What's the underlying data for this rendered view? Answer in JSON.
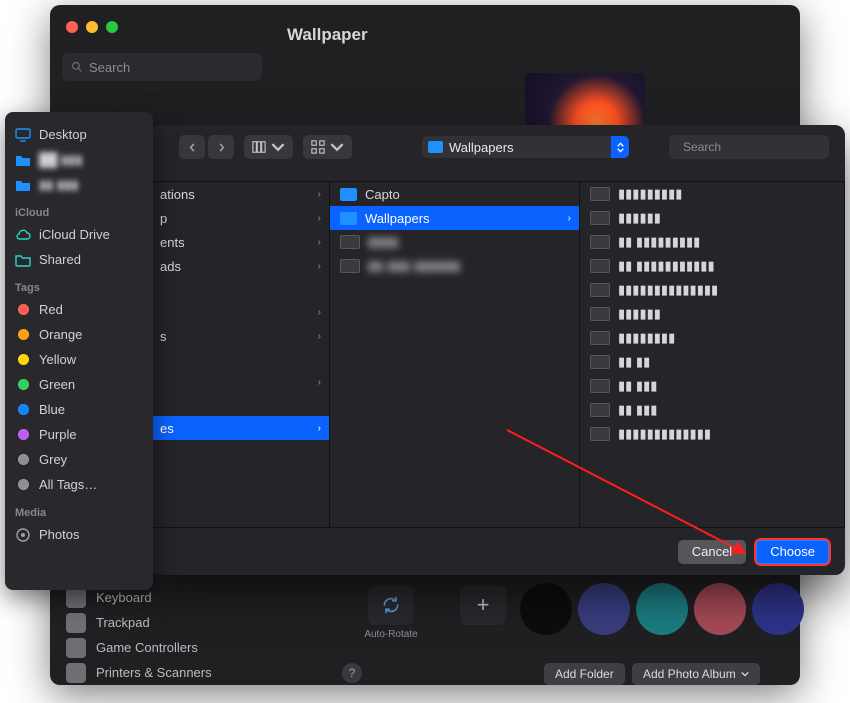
{
  "window": {
    "title": "Wallpaper",
    "search_placeholder": "Search",
    "auto_rotate_label": "Auto-Rotate",
    "add_folder_label": "Add Folder",
    "add_album_label": "Add Photo Album",
    "swatches": [
      "#0d0d0d",
      "#3a3e7f",
      "#1c7d82",
      "#a64a55",
      "#2e338a"
    ],
    "sidebar_below": [
      {
        "label": "Keyboard"
      },
      {
        "label": "Trackpad"
      },
      {
        "label": "Game Controllers"
      },
      {
        "label": "Printers & Scanners"
      }
    ]
  },
  "favorites": {
    "top": [
      {
        "label": "Desktop",
        "icon": "desktop",
        "blur": false
      },
      {
        "label": "██ ▮▮▮",
        "icon": "folder",
        "blur": true
      },
      {
        "label": "▮▮ ▮▮▮",
        "icon": "folder",
        "blur": true
      }
    ],
    "icloud_header": "iCloud",
    "icloud": [
      {
        "label": "iCloud Drive",
        "icon": "cloud"
      },
      {
        "label": "Shared",
        "icon": "shared"
      }
    ],
    "tags_header": "Tags",
    "tags": [
      {
        "label": "Red",
        "color": "#ff5a52"
      },
      {
        "label": "Orange",
        "color": "#ff9f0a"
      },
      {
        "label": "Yellow",
        "color": "#ffd60a"
      },
      {
        "label": "Green",
        "color": "#30d158"
      },
      {
        "label": "Blue",
        "color": "#0a84ff"
      },
      {
        "label": "Purple",
        "color": "#bf5af2"
      },
      {
        "label": "Grey",
        "color": "#8e8e93"
      }
    ],
    "all_tags_label": "All Tags…",
    "media_header": "Media",
    "media": [
      {
        "label": "Photos",
        "icon": "photos"
      }
    ]
  },
  "dialog": {
    "path_label": "Wallpapers",
    "search_placeholder": "Search",
    "col1": [
      {
        "label": "ations",
        "sel": false,
        "partial": true
      },
      {
        "label": "p",
        "sel": false,
        "partial": true
      },
      {
        "label": "ents",
        "sel": false,
        "partial": true
      },
      {
        "label": "ads",
        "sel": false,
        "partial": true
      },
      {
        "label": "",
        "sel": false,
        "partial": true
      },
      {
        "label": "s",
        "sel": false,
        "partial": true
      },
      {
        "label": "",
        "sel": false,
        "partial": true
      },
      {
        "label": "es",
        "sel": true,
        "partial": true
      }
    ],
    "col2": [
      {
        "label": "Capto",
        "sel": false,
        "blur": false
      },
      {
        "label": "Wallpapers",
        "sel": true,
        "blur": false,
        "chev": true
      },
      {
        "label": "▮▮▮▮",
        "sel": false,
        "blur": true,
        "thumb": true
      },
      {
        "label": "▮▮ ▮▮▮ ▮▮▮▮▮▮",
        "sel": false,
        "blur": true,
        "thumb": true
      }
    ],
    "col3": [
      {
        "label": "▮▮▮▮▮▮▮▮▮"
      },
      {
        "label": "▮▮▮▮▮▮"
      },
      {
        "label": "▮▮ ▮▮▮▮▮▮▮▮▮"
      },
      {
        "label": "▮▮ ▮▮▮▮▮▮▮▮▮▮▮"
      },
      {
        "label": "▮▮▮▮▮▮▮▮▮▮▮▮▮▮"
      },
      {
        "label": "▮▮▮▮▮▮"
      },
      {
        "label": "▮▮▮▮▮▮▮▮"
      },
      {
        "label": "▮▮ ▮▮"
      },
      {
        "label": "▮▮ ▮▮▮"
      },
      {
        "label": "▮▮ ▮▮▮"
      },
      {
        "label": "▮▮▮▮▮▮▮▮▮▮▮▮▮"
      }
    ],
    "cancel_label": "Cancel",
    "choose_label": "Choose"
  }
}
